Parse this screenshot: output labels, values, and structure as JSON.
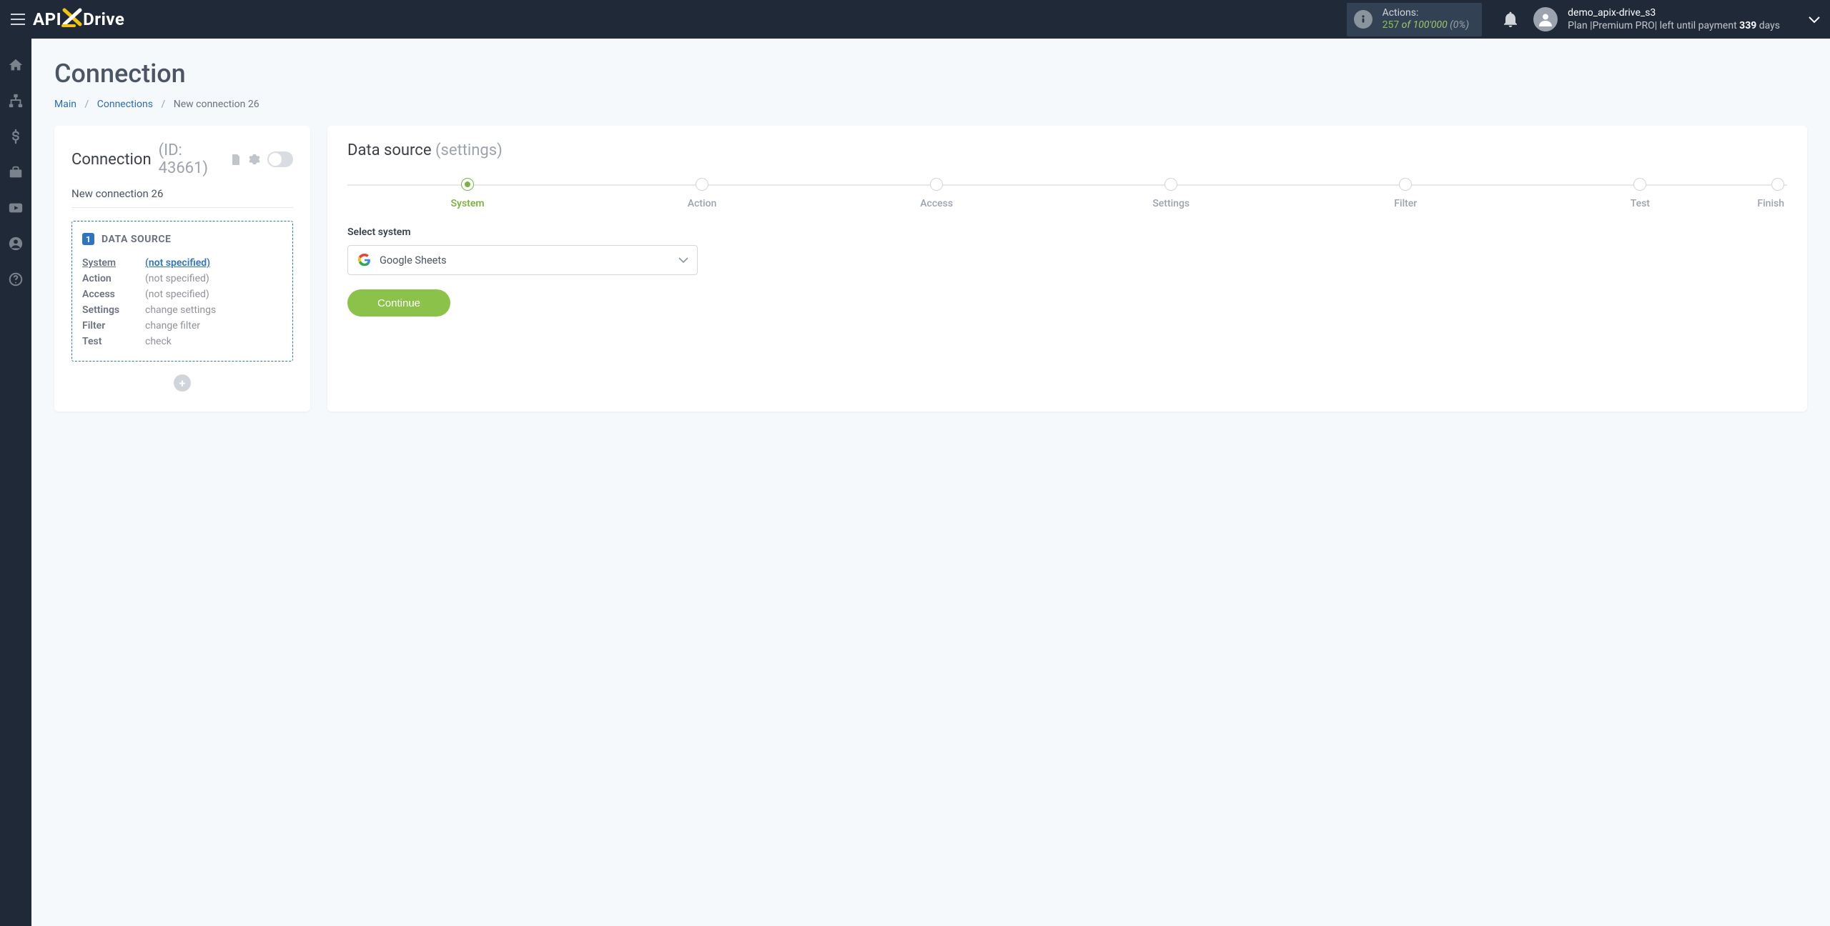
{
  "header": {
    "brand_left": "API",
    "brand_right": "Drive",
    "actions_label": "Actions:",
    "actions_count": "257",
    "actions_of": " of ",
    "actions_total": "100'000",
    "actions_pct": " (0%)",
    "user_name": "demo_apix-drive_s3",
    "plan_line_prefix": "Plan |Premium PRO| left until payment ",
    "plan_days": "339",
    "plan_days_suffix": " days"
  },
  "page": {
    "title": "Connection",
    "breadcrumb": {
      "main": "Main",
      "connections": "Connections",
      "current": "New connection 26"
    }
  },
  "left_card": {
    "title": "Connection",
    "id_label": "(ID: 43661)",
    "connection_name": "New connection 26",
    "step_number": "1",
    "step_title": "DATA SOURCE",
    "rows": [
      {
        "k": "System",
        "v": "(not specified)",
        "active": true
      },
      {
        "k": "Action",
        "v": "(not specified)",
        "active": false
      },
      {
        "k": "Access",
        "v": "(not specified)",
        "active": false
      },
      {
        "k": "Settings",
        "v": "change settings",
        "active": false
      },
      {
        "k": "Filter",
        "v": "change filter",
        "active": false
      },
      {
        "k": "Test",
        "v": "check",
        "active": false
      }
    ]
  },
  "right_card": {
    "title": "Data source",
    "subtitle": "(settings)",
    "steps": [
      "System",
      "Action",
      "Access",
      "Settings",
      "Filter",
      "Test",
      "Finish"
    ],
    "active_step": 0,
    "field_label": "Select system",
    "selected_system": "Google Sheets",
    "continue": "Continue"
  }
}
